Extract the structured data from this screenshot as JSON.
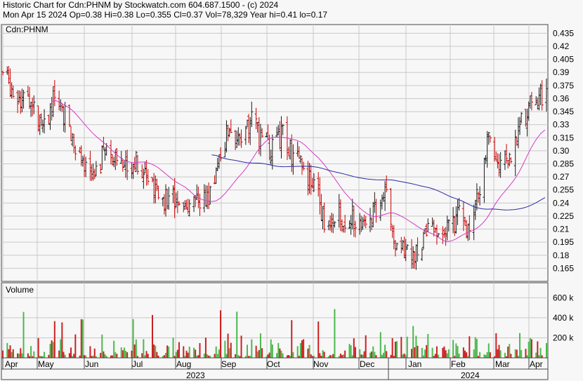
{
  "header": {
    "title": "Historic Chart for Cdn:PHNM by Stockwatch.com 604.687.1500 - (c) 2024",
    "subtitle": "Mon Apr 15 2024   Op=0.38   Hi=0.38   Lo=0.355   Cl=0.37   Vol=78,329   Year hi=0.41   lo=0.17"
  },
  "colors": {
    "up": "#1a1a1a",
    "down": "#cc0000",
    "ma_fast": "#d43cc8",
    "ma_slow": "#2a2aa8",
    "vol_up": "#4cb84c",
    "vol_down": "#cc2020",
    "grid": "#c8c8c8"
  },
  "chart_data": [
    {
      "type": "ohlc",
      "label": "Cdn:PHNM",
      "ylim": [
        0.15,
        0.445
      ],
      "yticks": [
        "0.435",
        "0.42",
        "0.405",
        "0.39",
        "0.375",
        "0.36",
        "0.345",
        "0.33",
        "0.315",
        "0.30",
        "0.285",
        "0.27",
        "0.255",
        "0.24",
        "0.225",
        "0.21",
        "0.195",
        "0.18",
        "0.165"
      ],
      "close_series": [
        [
          "2023-04-14",
          0.39
        ],
        [
          "2023-04-21",
          0.37
        ],
        [
          "2023-04-28",
          0.36
        ],
        [
          "2023-05-05",
          0.35
        ],
        [
          "2023-05-12",
          0.33
        ],
        [
          "2023-05-19",
          0.36
        ],
        [
          "2023-05-26",
          0.34
        ],
        [
          "2023-06-02",
          0.29
        ],
        [
          "2023-06-09",
          0.28
        ],
        [
          "2023-06-16",
          0.28
        ],
        [
          "2023-06-23",
          0.3
        ],
        [
          "2023-06-30",
          0.29
        ],
        [
          "2023-07-07",
          0.28
        ],
        [
          "2023-07-14",
          0.29
        ],
        [
          "2023-07-21",
          0.26
        ],
        [
          "2023-07-28",
          0.25
        ],
        [
          "2023-08-04",
          0.24
        ],
        [
          "2023-08-11",
          0.25
        ],
        [
          "2023-08-18",
          0.23
        ],
        [
          "2023-08-25",
          0.24
        ],
        [
          "2023-09-01",
          0.245
        ],
        [
          "2023-09-08",
          0.3
        ],
        [
          "2023-09-15",
          0.33
        ],
        [
          "2023-09-22",
          0.3
        ],
        [
          "2023-09-29",
          0.34
        ],
        [
          "2023-10-06",
          0.31
        ],
        [
          "2023-10-13",
          0.3
        ],
        [
          "2023-10-20",
          0.32
        ],
        [
          "2023-10-27",
          0.29
        ],
        [
          "2023-11-03",
          0.28
        ],
        [
          "2023-11-10",
          0.26
        ],
        [
          "2023-11-17",
          0.22
        ],
        [
          "2023-11-24",
          0.23
        ],
        [
          "2023-12-01",
          0.22
        ],
        [
          "2023-12-08",
          0.225
        ],
        [
          "2023-12-15",
          0.22
        ],
        [
          "2023-12-22",
          0.235
        ],
        [
          "2023-12-29",
          0.25
        ],
        [
          "2024-01-05",
          0.19
        ],
        [
          "2024-01-12",
          0.185
        ],
        [
          "2024-01-19",
          0.18
        ],
        [
          "2024-01-26",
          0.21
        ],
        [
          "2024-02-02",
          0.205
        ],
        [
          "2024-02-09",
          0.21
        ],
        [
          "2024-02-16",
          0.225
        ],
        [
          "2024-02-23",
          0.2
        ],
        [
          "2024-03-01",
          0.26
        ],
        [
          "2024-03-08",
          0.32
        ],
        [
          "2024-03-15",
          0.28
        ],
        [
          "2024-03-22",
          0.3
        ],
        [
          "2024-03-29",
          0.33
        ],
        [
          "2024-04-05",
          0.36
        ],
        [
          "2024-04-12",
          0.365
        ],
        [
          "2024-04-15",
          0.37
        ]
      ],
      "ma_fast": [
        [
          0.36,
          0.355
        ],
        [
          0.31,
          0.32
        ],
        [
          0.28,
          0.28
        ],
        [
          0.26,
          0.24
        ],
        [
          0.245,
          0.25
        ],
        [
          0.28,
          0.295
        ],
        [
          0.305,
          0.28
        ],
        [
          0.235,
          0.22
        ],
        [
          0.21,
          0.205
        ],
        [
          0.205,
          0.23
        ],
        [
          0.28,
          0.32
        ]
      ],
      "ma_slow": [
        [
          0.305,
          0.28
        ],
        [
          0.28,
          0.28
        ],
        [
          0.275,
          0.265
        ],
        [
          0.26,
          0.255
        ],
        [
          0.245,
          0.24
        ],
        [
          0.243,
          0.25
        ]
      ]
    },
    {
      "type": "bar",
      "label": "Volume",
      "ylim": [
        0,
        750000
      ],
      "yticks": [
        "600 k",
        "400 k",
        "200 k"
      ]
    }
  ],
  "xaxis": {
    "months": [
      "Apr",
      "May",
      "Jun",
      "Jul",
      "Aug",
      "Sep",
      "Oct",
      "Nov",
      "Dec",
      "Jan",
      "Feb",
      "Mar",
      "Apr"
    ],
    "years": [
      "2023",
      "2024"
    ]
  }
}
